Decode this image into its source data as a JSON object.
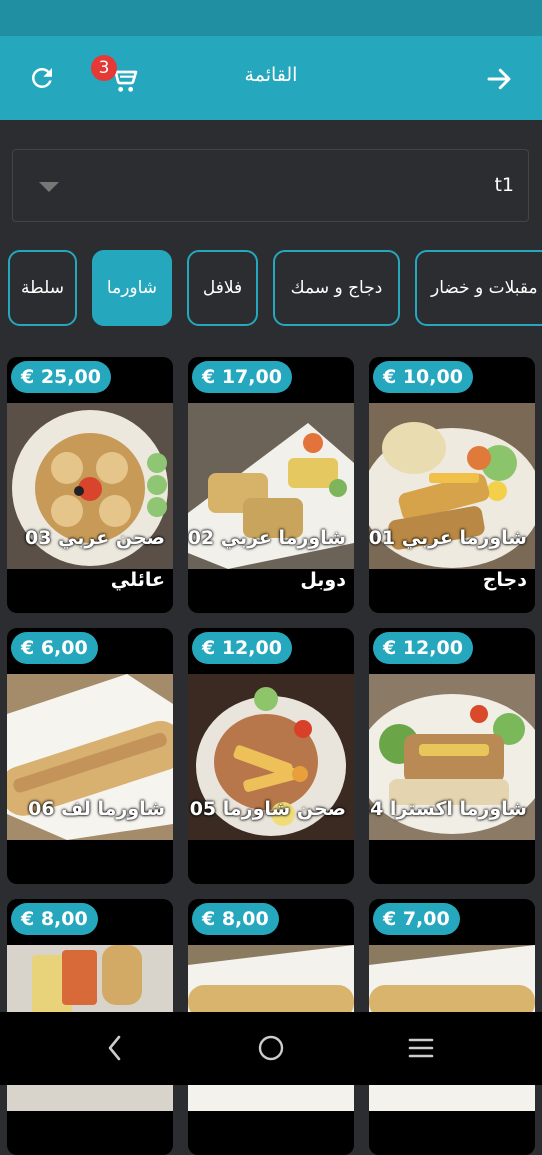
{
  "header": {
    "title": "القائمة",
    "cart_count": "3"
  },
  "table_select": {
    "value": "t1"
  },
  "categories": [
    {
      "label": "مقبلات و خضار"
    },
    {
      "label": "دجاج و سمك"
    },
    {
      "label": "فلافل"
    },
    {
      "label": "شاورما"
    },
    {
      "label": "سلطة"
    }
  ],
  "active_category": "شاورما",
  "products": [
    {
      "price": "€ 10,00",
      "name": "01 شاورما عربي",
      "sub": "دجاج"
    },
    {
      "price": "€ 17,00",
      "name": "02 شاورما عربي",
      "sub": "دوبل"
    },
    {
      "price": "€ 25,00",
      "name": "03 صحن عربي",
      "sub": "عائلي"
    },
    {
      "price": "€ 12,00",
      "name": "04 شاورما اكسترا",
      "sub": ""
    },
    {
      "price": "€ 12,00",
      "name": "05 صحن شاورما",
      "sub": ""
    },
    {
      "price": "€ 6,00",
      "name": "06 شاورما لف",
      "sub": ""
    },
    {
      "price": "€ 7,00",
      "name": "",
      "sub": ""
    },
    {
      "price": "€ 8,00",
      "name": "",
      "sub": ""
    },
    {
      "price": "€ 8,00",
      "name": "",
      "sub": ""
    }
  ],
  "icons": {
    "refresh": "refresh-icon",
    "cart": "cart-icon",
    "back": "arrow-right-icon",
    "nav_back": "chevron-left-icon",
    "nav_home": "circle-home-icon",
    "nav_menu": "menu-icon"
  },
  "colors": {
    "accent": "#25a7bd",
    "status_bar": "#1f8fa1",
    "background": "#2b2d30",
    "badge": "#e53935"
  }
}
